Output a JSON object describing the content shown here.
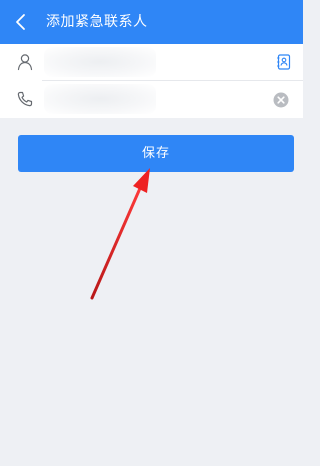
{
  "header": {
    "title": "添加紧急联系人",
    "back_icon": "chevron-left-icon",
    "background": "#2f86f6"
  },
  "form": {
    "name": {
      "icon": "person-icon",
      "value": "",
      "action_icon": "address-book-icon"
    },
    "phone": {
      "icon": "phone-icon",
      "value": "",
      "action_icon": "clear-icon"
    }
  },
  "save_button": {
    "label": "保存",
    "color": "#2f86f6"
  },
  "annotation": {
    "type": "arrow",
    "color": "#e02020",
    "points_to": "save-button"
  }
}
